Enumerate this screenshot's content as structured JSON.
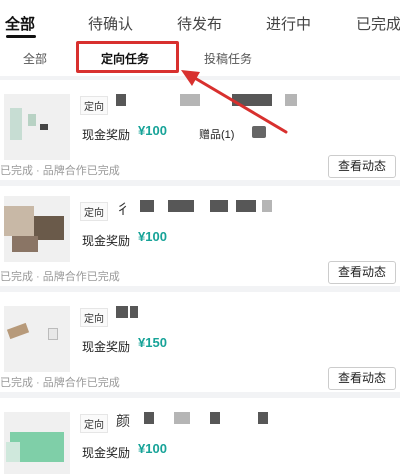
{
  "top_tabs": [
    "全部",
    "待确认",
    "待发布",
    "进行中",
    "已完成"
  ],
  "sub_tabs": [
    "全部",
    "定向任务",
    "投稿任务"
  ],
  "cards": [
    {
      "tag": "定向",
      "name_visible": "",
      "reward_label": "现金奖励",
      "reward": "¥100",
      "gift": "赠品(1)",
      "status": "已完成 · 品牌合作已完成",
      "button": "查看动态"
    },
    {
      "tag": "定向",
      "name_visible": "彳",
      "reward_label": "现金奖励",
      "reward": "¥100",
      "status": "已完成 · 品牌合作已完成",
      "button": "查看动态"
    },
    {
      "tag": "定向",
      "name_visible": "",
      "reward_label": "现金奖励",
      "reward": "¥150",
      "status": "已完成 · 品牌合作已完成",
      "button": "查看动态"
    },
    {
      "tag": "定向",
      "name_visible": "颜",
      "reward_label": "现金奖励",
      "reward": "¥100"
    }
  ],
  "colors": {
    "accent": "#17a398",
    "highlight": "#d8302e"
  }
}
